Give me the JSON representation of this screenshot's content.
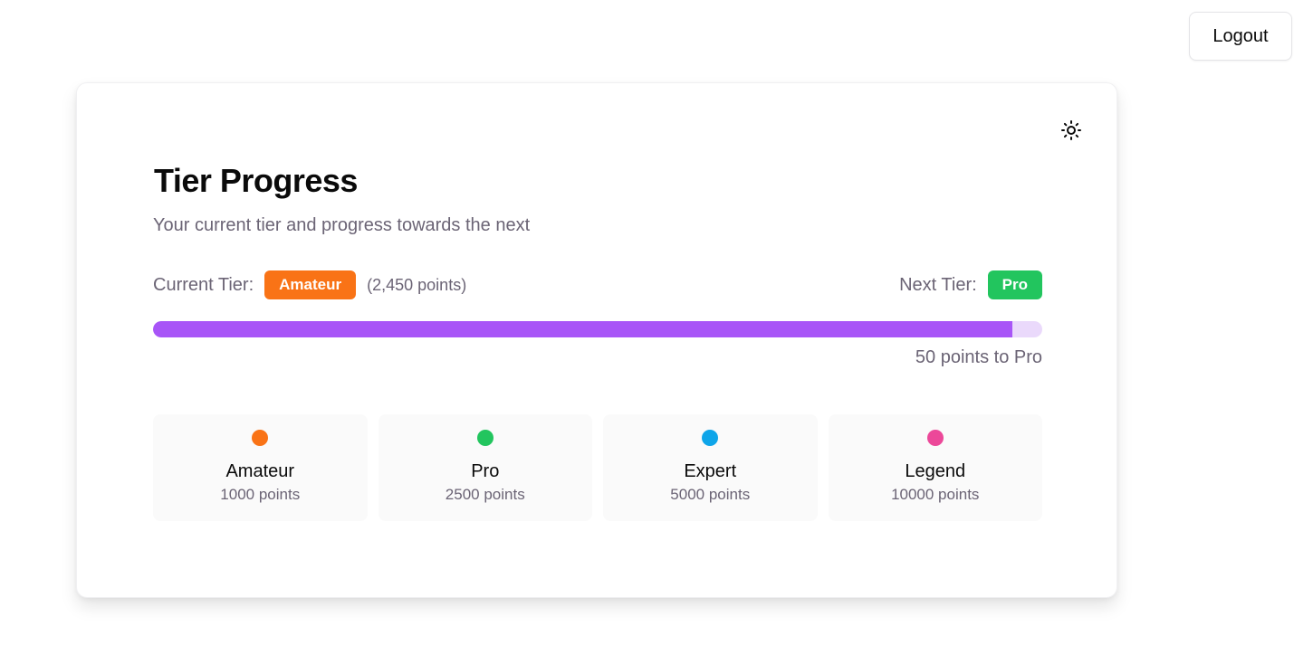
{
  "header": {
    "logout_label": "Logout"
  },
  "card": {
    "theme_icon": "sun-icon",
    "title": "Tier Progress",
    "subtitle": "Your current tier and progress towards the next",
    "current_tier": {
      "label": "Current Tier:",
      "name": "Amateur",
      "color": "#f97316",
      "points_note": "(2,450 points)"
    },
    "next_tier": {
      "label": "Next Tier:",
      "name": "Pro",
      "color": "#22c55e"
    },
    "progress": {
      "percent": 96.6,
      "fill_color": "#a855f7",
      "track_color": "#ead9fb",
      "caption": "50 points to Pro"
    },
    "tiers": [
      {
        "name": "Amateur",
        "points": "1000 points",
        "color": "#f97316"
      },
      {
        "name": "Pro",
        "points": "2500 points",
        "color": "#22c55e"
      },
      {
        "name": "Expert",
        "points": "5000 points",
        "color": "#0ea5e9"
      },
      {
        "name": "Legend",
        "points": "10000 points",
        "color": "#ec4899"
      }
    ]
  }
}
